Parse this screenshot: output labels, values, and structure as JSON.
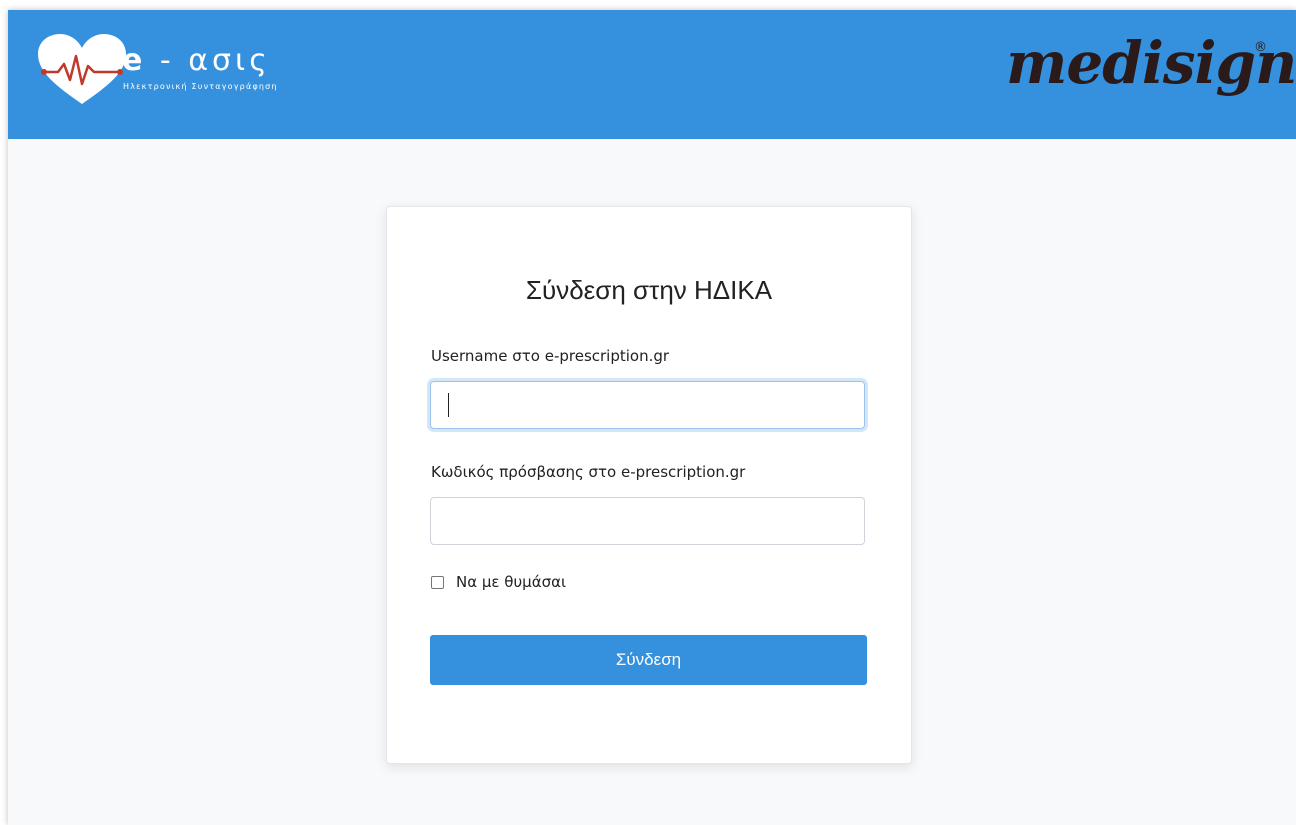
{
  "header": {
    "brand_main_prefix": "e",
    "brand_main_rest": "- ασις",
    "brand_subtitle": "Ηλεκτρονική Συνταγογράφηση",
    "partner_logo_text": "medisign",
    "partner_logo_mark": "®",
    "icons": {
      "brand_logo": "heart-pulse-icon"
    },
    "colors": {
      "header_bg": "#3591de",
      "heart": "#ffffff",
      "pulse_line": "#c0392b"
    }
  },
  "login": {
    "title": "Σύνδεση στην ΗΔΙΚΑ",
    "username_label": "Username στο e-prescription.gr",
    "username_value": "",
    "password_label": "Κωδικός πρόσβασης στο e-prescription.gr",
    "password_value": "",
    "remember_label": "Να με θυμάσαι",
    "remember_checked": false,
    "submit_label": "Σύνδεση",
    "colors": {
      "button_bg": "#3591de",
      "focus_ring": "#9cc3ee"
    }
  }
}
